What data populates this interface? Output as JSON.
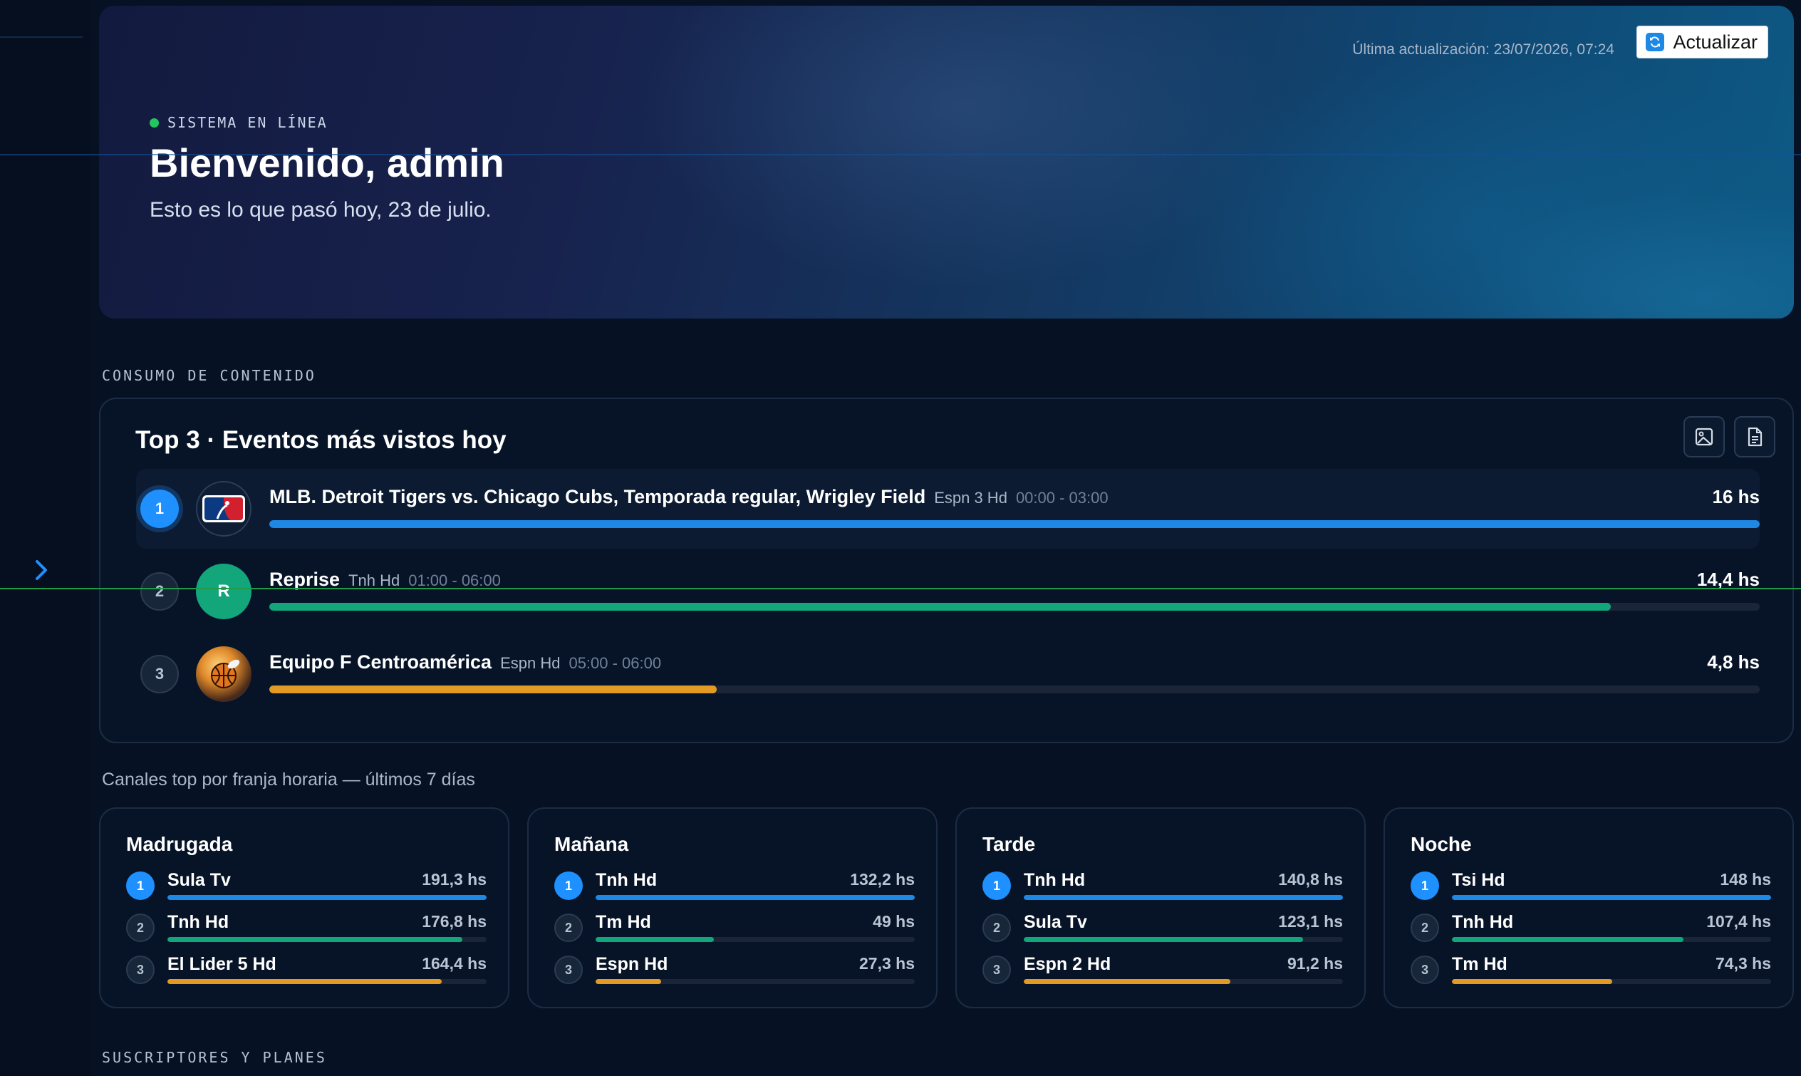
{
  "colors": {
    "blue": "#1e88e5",
    "green": "#12a67a",
    "orange": "#e39a25",
    "online": "#22c55e"
  },
  "hero": {
    "status": "SISTEMA EN LÍNEA",
    "title": "Bienvenido, admin",
    "subtitle": "Esto es lo que pasó hoy, 23 de julio.",
    "last_update": "Última actualización: 23/07/2026, 07:24",
    "refresh_label": "Actualizar"
  },
  "sections": {
    "consumo": "CONSUMO DE CONTENIDO",
    "suscriptores": "SUSCRIPTORES Y PLANES"
  },
  "top3": {
    "title": "Top 3 · Eventos más vistos hoy",
    "events": [
      {
        "rank": "1",
        "name": "MLB. Detroit Tigers vs. Chicago Cubs, Temporada regular, Wrigley Field",
        "channel": "Espn 3 Hd",
        "time": "00:00 - 03:00",
        "hours": "16 hs",
        "level": 1.0,
        "color": "#1e88e5",
        "logo": "mlb-logo"
      },
      {
        "rank": "2",
        "name": "Reprise",
        "channel": "Tnh Hd",
        "time": "01:00 - 06:00",
        "hours": "14,4 hs",
        "level": 0.9,
        "color": "#12a67a",
        "logo": "letter-avatar",
        "logo_letter": "R"
      },
      {
        "rank": "3",
        "name": "Equipo F Centroamérica",
        "channel": "Espn Hd",
        "time": "05:00 - 06:00",
        "hours": "4,8 hs",
        "level": 0.3,
        "color": "#e39a25",
        "logo": "sports-ball-logo"
      }
    ]
  },
  "franja": {
    "caption": "Canales top por franja horaria — últimos 7 días",
    "slots": [
      {
        "title": "Madrugada",
        "channels": [
          {
            "rank": "1",
            "name": "Sula Tv",
            "hours": "191,3 hs",
            "level": 1.0
          },
          {
            "rank": "2",
            "name": "Tnh Hd",
            "hours": "176,8 hs",
            "level": 0.924
          },
          {
            "rank": "3",
            "name": "El Lider 5 Hd",
            "hours": "164,4 hs",
            "level": 0.859
          }
        ]
      },
      {
        "title": "Mañana",
        "channels": [
          {
            "rank": "1",
            "name": "Tnh Hd",
            "hours": "132,2 hs",
            "level": 1.0
          },
          {
            "rank": "2",
            "name": "Tm Hd",
            "hours": "49 hs",
            "level": 0.371
          },
          {
            "rank": "3",
            "name": "Espn Hd",
            "hours": "27,3 hs",
            "level": 0.206
          }
        ]
      },
      {
        "title": "Tarde",
        "channels": [
          {
            "rank": "1",
            "name": "Tnh Hd",
            "hours": "140,8 hs",
            "level": 1.0
          },
          {
            "rank": "2",
            "name": "Sula Tv",
            "hours": "123,1 hs",
            "level": 0.874
          },
          {
            "rank": "3",
            "name": "Espn 2 Hd",
            "hours": "91,2 hs",
            "level": 0.648
          }
        ]
      },
      {
        "title": "Noche",
        "channels": [
          {
            "rank": "1",
            "name": "Tsi Hd",
            "hours": "148 hs",
            "level": 1.0
          },
          {
            "rank": "2",
            "name": "Tnh Hd",
            "hours": "107,4 hs",
            "level": 0.726
          },
          {
            "rank": "3",
            "name": "Tm Hd",
            "hours": "74,3 hs",
            "level": 0.502
          }
        ]
      }
    ]
  }
}
